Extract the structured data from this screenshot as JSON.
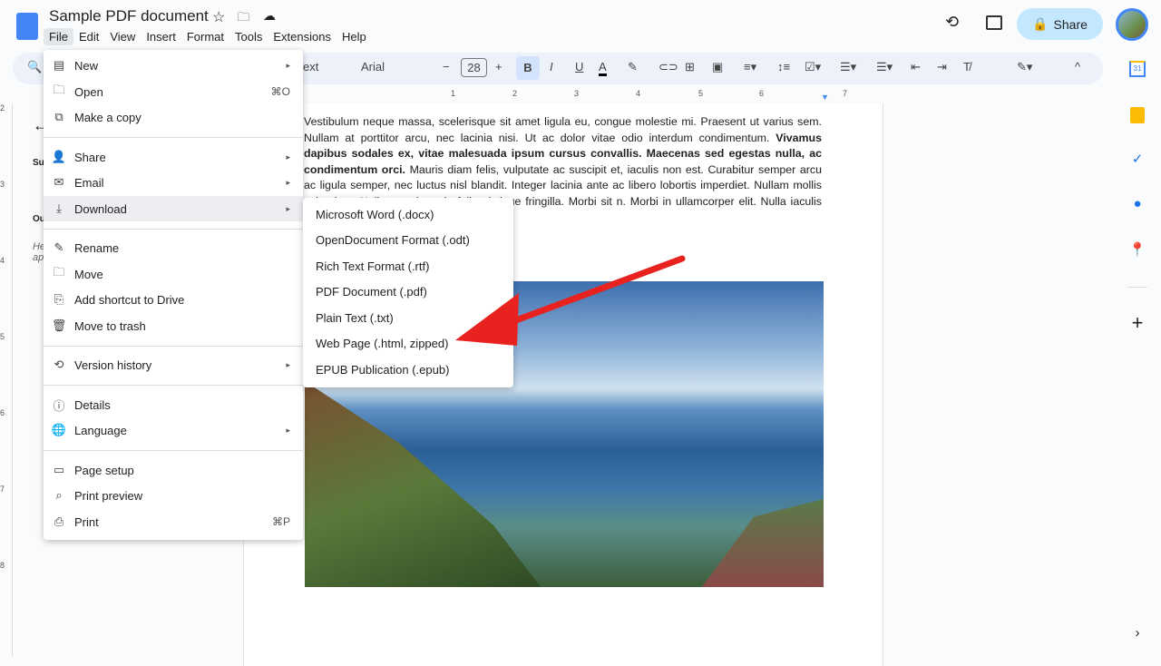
{
  "header": {
    "title": "Sample PDF document",
    "share_label": "Share",
    "icons": [
      "docs-logo-icon",
      "star-icon",
      "move-folder-icon",
      "cloud-saved-icon",
      "history-icon",
      "comments-icon",
      "lock-icon",
      "avatar"
    ]
  },
  "menubar": [
    "File",
    "Edit",
    "View",
    "Insert",
    "Format",
    "Tools",
    "Extensions",
    "Help"
  ],
  "toolbar": {
    "style_partial": "ext",
    "font": "Arial",
    "font_size": "28",
    "minus": "−",
    "plus": "+"
  },
  "ruler": [
    "1",
    "2",
    "3",
    "4",
    "5",
    "6",
    "7"
  ],
  "left_ruler": [
    "2",
    "3",
    "4",
    "5",
    "6",
    "7",
    "8"
  ],
  "outline_partial": {
    "summary": "Su",
    "outline": "Ou",
    "hint": "He ap"
  },
  "document": {
    "p1": "Vestibulum neque massa, scelerisque sit amet ligula eu, congue molestie mi. Praesent ut varius sem. Nullam at porttitor arcu, nec lacinia nisi. Ut ac dolor vitae odio interdum condimentum. ",
    "bold": "Vivamus dapibus sodales ex, vitae malesuada ipsum cursus convallis. Maecenas sed egestas nulla, ac condimentum orci.",
    "p2": " Mauris diam felis, vulputate ac suscipit et, iaculis non est. Curabitur semper arcu ac ligula semper, nec luctus nisl blandit. Integer lacinia ante ac libero lobortis imperdiet. Nullam mollis cula vitae. Nulla eget justo in felis tristique fringilla. Morbi sit n. Morbi in ullamcorper elit. Nulla iaculis tellus sit amet mauris"
  },
  "file_menu": {
    "items": [
      {
        "label": "New",
        "icon": "new-doc-icon",
        "submenu": true
      },
      {
        "label": "Open",
        "icon": "folder-icon",
        "shortcut": "⌘O"
      },
      {
        "label": "Make a copy",
        "icon": "copy-icon"
      },
      {
        "label": "Share",
        "icon": "share-icon",
        "submenu": true
      },
      {
        "label": "Email",
        "icon": "email-icon",
        "submenu": true
      },
      {
        "label": "Download",
        "icon": "download-icon",
        "submenu": true,
        "highlighted": true
      },
      {
        "label": "Rename",
        "icon": "rename-icon"
      },
      {
        "label": "Move",
        "icon": "move-icon"
      },
      {
        "label": "Add shortcut to Drive",
        "icon": "shortcut-icon"
      },
      {
        "label": "Move to trash",
        "icon": "trash-icon"
      },
      {
        "label": "Version history",
        "icon": "history-icon",
        "submenu": true
      },
      {
        "label": "Details",
        "icon": "info-icon"
      },
      {
        "label": "Language",
        "icon": "globe-icon",
        "submenu": true
      },
      {
        "label": "Page setup",
        "icon": "page-icon"
      },
      {
        "label": "Print preview",
        "icon": "print-preview-icon"
      },
      {
        "label": "Print",
        "icon": "print-icon",
        "shortcut": "⌘P"
      }
    ]
  },
  "download_menu": [
    "Microsoft Word (.docx)",
    "OpenDocument Format (.odt)",
    "Rich Text Format (.rtf)",
    "PDF Document (.pdf)",
    "Plain Text (.txt)",
    "Web Page (.html, zipped)",
    "EPUB Publication (.epub)"
  ],
  "annotation": {
    "arrow_color": "#e8231f",
    "points_to": "Web Page (.html, zipped)"
  },
  "side_panel": {
    "icons": [
      "calendar-icon",
      "keep-icon",
      "tasks-icon",
      "contacts-icon",
      "maps-icon",
      "add-icon",
      "expand-icon"
    ],
    "calendar_day": "31"
  }
}
